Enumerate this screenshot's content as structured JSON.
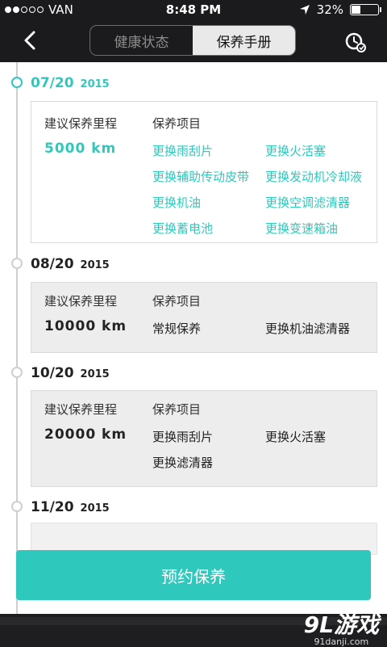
{
  "status": {
    "carrier": "VAN",
    "time": "8:48 PM",
    "battery": "32%",
    "battery_level": 0.32
  },
  "nav": {
    "tabs": [
      {
        "label": "健康状态",
        "selected": false
      },
      {
        "label": "保养手册",
        "selected": true
      }
    ]
  },
  "timeline": [
    {
      "date": "07/20",
      "year": "2015",
      "active": true,
      "mileage_label": "建议保养里程",
      "mileage": "5000  km",
      "items_label": "保养项目",
      "items": [
        "更换雨刮片",
        "更换火活塞",
        "更换辅助传动皮带",
        "更换发动机冷却液",
        "更换机油",
        "更换空调滤清器",
        "更换蓄电池",
        "更换变速箱油"
      ]
    },
    {
      "date": "08/20",
      "year": "2015",
      "active": false,
      "mileage_label": "建议保养里程",
      "mileage": "10000  km",
      "items_label": "保养项目",
      "items": [
        "常规保养",
        "更换机油滤清器"
      ]
    },
    {
      "date": "10/20",
      "year": "2015",
      "active": false,
      "mileage_label": "建议保养里程",
      "mileage": "20000  km",
      "items_label": "保养项目",
      "items": [
        "更换雨刮片",
        "更换火活塞",
        "更换滤清器"
      ]
    },
    {
      "date": "11/20",
      "year": "2015",
      "active": false
    }
  ],
  "actions": {
    "book_label": "预约保养"
  },
  "watermark": {
    "main": "9L游戏",
    "sub": "91danji.com"
  },
  "colors": {
    "accent": "#2fc8bd",
    "dark": "#1b1b1d"
  }
}
